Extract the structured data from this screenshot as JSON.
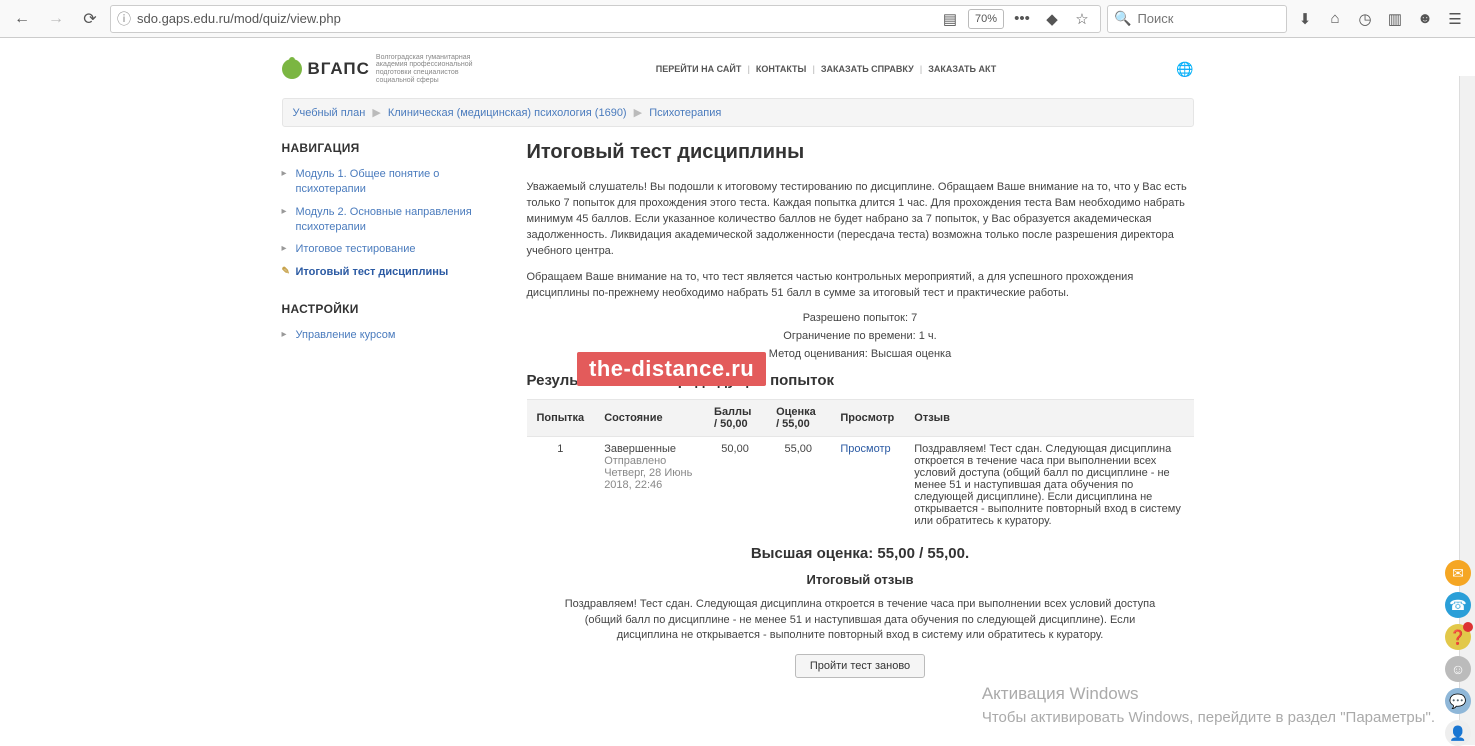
{
  "browser": {
    "url": "sdo.gaps.edu.ru/mod/quiz/view.php",
    "zoom": "70%",
    "search_placeholder": "Поиск"
  },
  "site": {
    "brand": "ВГАПС",
    "brand_sub": "Волгоградская гуманитарная академия профессиональной подготовки специалистов социальной сферы",
    "top_links": [
      "ПЕРЕЙТИ НА САЙТ",
      "КОНТАКТЫ",
      "ЗАКАЗАТЬ СПРАВКУ",
      "ЗАКАЗАТЬ АКТ"
    ]
  },
  "breadcrumbs": [
    "Учебный план",
    "Клиническая (медицинская) психология (1690)",
    "Психотерапия"
  ],
  "sidebar": {
    "nav_title": "НАВИГАЦИЯ",
    "nav_items": [
      "Модуль 1. Общее понятие о психотерапии",
      "Модуль 2. Основные направления психотерапии",
      "Итоговое тестирование",
      "Итоговый тест дисциплины"
    ],
    "settings_title": "НАСТРОЙКИ",
    "settings_items": [
      "Управление курсом"
    ]
  },
  "content": {
    "h1": "Итоговый тест дисциплины",
    "p1": "Уважаемый слушатель! Вы подошли к итоговому тестированию по дисциплине. Обращаем Ваше внимание на то, что у Вас есть только 7 попыток для прохождения этого теста.  Каждая попытка длится 1 час. Для прохождения теста Вам необходимо набрать минимум 45 баллов. Если указанное количество баллов не будет набрано за 7 попыток, у Вас образуется академическая задолженность. Ликвидация академической задолженности (пересдача теста) возможна только после разрешения директора учебного центра.",
    "p2": "Обращаем Ваше внимание на то, что тест является частью контрольных мероприятий, а для успешного прохождения дисциплины по-прежнему необходимо набрать 51 балл в сумме за итоговый тест и практические работы.",
    "meta1": "Разрешено попыток: 7",
    "meta2": "Ограничение по времени: 1 ч.",
    "meta3": "Метод оценивания: Высшая оценка",
    "h2_results": "Результаты ваших предыдущих попыток",
    "table": {
      "head": [
        "Попытка",
        "Состояние",
        "Баллы / 50,00",
        "Оценка / 55,00",
        "Просмотр",
        "Отзыв"
      ],
      "row": {
        "attempt": "1",
        "state_line1": "Завершенные",
        "state_line2": "Отправлено Четверг, 28 Июнь 2018, 22:46",
        "points": "50,00",
        "grade": "55,00",
        "view": "Просмотр",
        "feedback": "Поздравляем! Тест сдан. Следующая дисциплина откроется в течение часа при выполнении всех условий доступа (общий балл по дисциплине - не менее 51 и наступившая дата обучения по следующей дисциплине). Если дисциплина не открывается - выполните повторный вход в систему или обратитесь к куратору."
      }
    },
    "best_grade": "Высшая оценка: 55,00 / 55,00.",
    "final_feedback_h": "Итоговый отзыв",
    "final_feedback": "Поздравляем! Тест сдан. Следующая дисциплина откроется в течение часа при выполнении всех условий доступа (общий балл по дисциплине - не менее 51 и наступившая дата обучения по следующей дисциплине). Если дисциплина не открывается - выполните повторный вход в систему или обратитесь к куратору.",
    "retake_btn": "Пройти тест заново"
  },
  "watermark": "the-distance.ru",
  "windows": {
    "title": "Активация Windows",
    "sub": "Чтобы активировать Windows, перейдите в раздел \"Параметры\"."
  }
}
